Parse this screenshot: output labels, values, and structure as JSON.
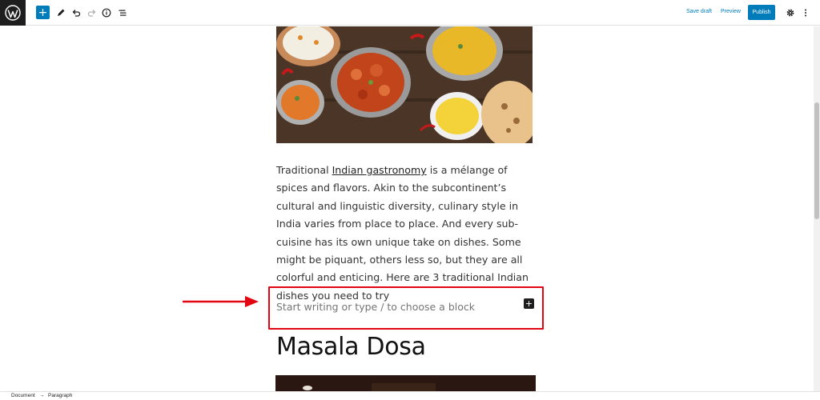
{
  "toolbar": {
    "save_draft": "Save draft",
    "preview": "Preview",
    "publish": "Publish",
    "inserter_symbol": "+",
    "icons": [
      "wordpress-logo",
      "add-block-icon",
      "pen-icon",
      "undo-icon",
      "redo-icon",
      "info-icon",
      "list-view-icon",
      "settings-gear-icon",
      "more-options-icon"
    ]
  },
  "content": {
    "paragraph": {
      "before_link": "Traditional ",
      "link": "Indian gastronomy",
      "after_link": " is a mélange of spices and flavors. Akin to the subcontinent’s cultural and linguistic diversity, culinary style in India varies from place to place. And every sub-cuisine has its own unique take on dishes. Some might be piquant, others less so, but they are all colorful and enticing. Here are 3 traditional Indian dishes you need to try"
    },
    "appender": {
      "placeholder": "Start writing or type / to choose a block",
      "plus": "+"
    },
    "heading": "Masala Dosa"
  },
  "footer": {
    "crumb_1": "Document",
    "separator": "→",
    "crumb_2": "Paragraph"
  },
  "colors": {
    "accent": "#007cba",
    "highlight_box": "#e20613",
    "arrow": "#e20613"
  }
}
